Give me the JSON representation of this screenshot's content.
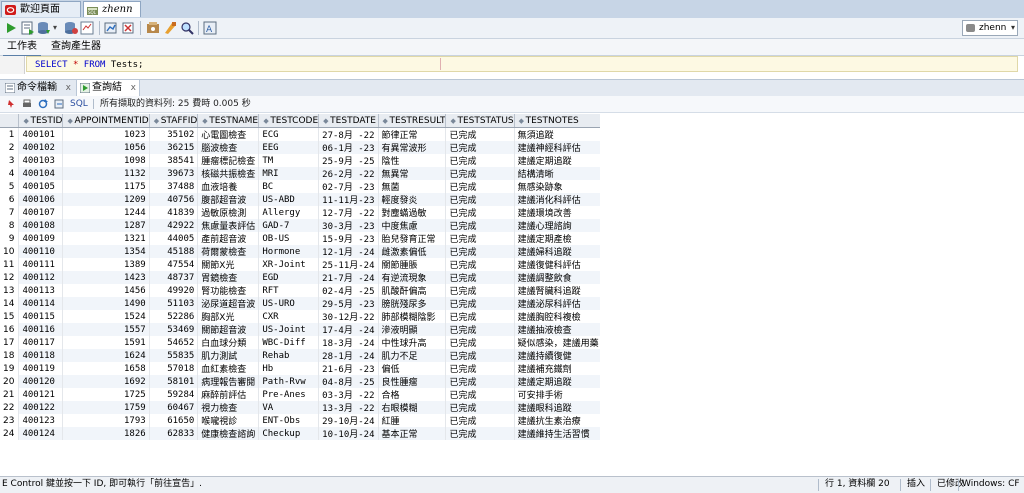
{
  "doc_tabs": [
    {
      "label": "歡迎頁面",
      "icon": "oracle-icon",
      "active": false
    },
    {
      "label": "zhenn",
      "icon": "sql-worksheet-icon",
      "active": true
    }
  ],
  "toolbar": {
    "connection": "zhenn",
    "buttons": [
      "run-icon",
      "run-script-icon",
      "commit-icon",
      "rollback-icon",
      "explain-plan-icon",
      "autotrace-icon",
      "clear-icon",
      "sql-history-icon",
      "format-icon",
      "find-icon",
      "monitor-icon"
    ]
  },
  "worksheet_tabs": [
    "工作表",
    "查詢產生器"
  ],
  "editor": {
    "line": "SELECT * FROM Tests;",
    "kw_select": "SELECT",
    "star": "*",
    "kw_from": "FROM",
    "table": "Tests;"
  },
  "output_tabs": [
    {
      "label": "命令檔輸出",
      "close": "x"
    },
    {
      "label": "查詢結果",
      "close": "x"
    }
  ],
  "results_bar": {
    "sql_label": "SQL",
    "message": "所有擷取的資料列: 25 費時 0.005 秒"
  },
  "grid": {
    "columns": [
      "TESTID",
      "APPOINTMENTID",
      "STAFFID",
      "TESTNAME",
      "TESTCODE",
      "TESTDATE",
      "TESTRESULT",
      "TESTSTATUS",
      "TESTNOTES"
    ],
    "rows": [
      [
        "1",
        "400101",
        "1023",
        "35102",
        "心電圖檢查",
        "ECG",
        "27-8月 -22",
        "節律正常",
        "已完成",
        "無須追蹤"
      ],
      [
        "2",
        "400102",
        "1056",
        "36215",
        "腦波檢查",
        "EEG",
        "06-1月 -23",
        "有異常波形",
        "已完成",
        "建議神經科評估"
      ],
      [
        "3",
        "400103",
        "1098",
        "38541",
        "腫瘤標記檢查",
        "TM",
        "25-9月 -25",
        "陰性",
        "已完成",
        "建議定期追蹤"
      ],
      [
        "4",
        "400104",
        "1132",
        "39673",
        "核磁共振檢查",
        "MRI",
        "26-2月 -22",
        "無異常",
        "已完成",
        "結構清晰"
      ],
      [
        "5",
        "400105",
        "1175",
        "37488",
        "血液培養",
        "BC",
        "02-7月 -23",
        "無菌",
        "已完成",
        "無感染跡象"
      ],
      [
        "6",
        "400106",
        "1209",
        "40756",
        "腹部超音波",
        "US-ABD",
        "11-11月-23",
        "輕度發炎",
        "已完成",
        "建議消化科評估"
      ],
      [
        "7",
        "400107",
        "1244",
        "41839",
        "過敏原檢測",
        "Allergy",
        "12-7月 -22",
        "對塵蟎過敏",
        "已完成",
        "建議環境改善"
      ],
      [
        "8",
        "400108",
        "1287",
        "42922",
        "焦慮量表評估",
        "GAD-7",
        "30-3月 -23",
        "中度焦慮",
        "已完成",
        "建議心理諮詢"
      ],
      [
        "9",
        "400109",
        "1321",
        "44005",
        "產前超音波",
        "OB-US",
        "15-9月 -23",
        "胎兒發育正常",
        "已完成",
        "建議定期產檢"
      ],
      [
        "10",
        "400110",
        "1354",
        "45188",
        "荷爾蒙檢查",
        "Hormone",
        "12-1月 -24",
        "雌激素偏低",
        "已完成",
        "建議婦科追蹤"
      ],
      [
        "11",
        "400111",
        "1389",
        "47554",
        "關節X光",
        "XR-Joint",
        "25-11月-24",
        "關節腫脹",
        "已完成",
        "建議復健科評估"
      ],
      [
        "12",
        "400112",
        "1423",
        "48737",
        "胃鏡檢查",
        "EGD",
        "21-7月 -24",
        "有逆流現象",
        "已完成",
        "建議調整飲食"
      ],
      [
        "13",
        "400113",
        "1456",
        "49920",
        "腎功能檢查",
        "RFT",
        "02-4月 -25",
        "肌酸酐偏高",
        "已完成",
        "建議腎臟科追蹤"
      ],
      [
        "14",
        "400114",
        "1490",
        "51103",
        "泌尿道超音波",
        "US-URO",
        "29-5月 -23",
        "膀胱殘尿多",
        "已完成",
        "建議泌尿科評估"
      ],
      [
        "15",
        "400115",
        "1524",
        "52286",
        "胸部X光",
        "CXR",
        "30-12月-22",
        "肺部模糊陰影",
        "已完成",
        "建議胸腔科複檢"
      ],
      [
        "16",
        "400116",
        "1557",
        "53469",
        "關節超音波",
        "US-Joint",
        "17-4月 -24",
        "滲液明顯",
        "已完成",
        "建議抽液檢查"
      ],
      [
        "17",
        "400117",
        "1591",
        "54652",
        "白血球分類",
        "WBC-Diff",
        "18-3月 -24",
        "中性球升高",
        "已完成",
        "疑似感染，建議用藥"
      ],
      [
        "18",
        "400118",
        "1624",
        "55835",
        "肌力測試",
        "Rehab",
        "28-1月 -24",
        "肌力不足",
        "已完成",
        "建議持續復健"
      ],
      [
        "19",
        "400119",
        "1658",
        "57018",
        "血紅素檢查",
        "Hb",
        "21-6月 -23",
        "偏低",
        "已完成",
        "建議補充鐵劑"
      ],
      [
        "20",
        "400120",
        "1692",
        "58101",
        "病理報告審閱",
        "Path-Rvw",
        "04-8月 -25",
        "良性腫瘤",
        "已完成",
        "建議定期追蹤"
      ],
      [
        "21",
        "400121",
        "1725",
        "59284",
        "麻醉前評估",
        "Pre-Anes",
        "03-3月 -22",
        "合格",
        "已完成",
        "可安排手術"
      ],
      [
        "22",
        "400122",
        "1759",
        "60467",
        "視力檢查",
        "VA",
        "13-3月 -22",
        "右眼模糊",
        "已完成",
        "建議眼科追蹤"
      ],
      [
        "23",
        "400123",
        "1793",
        "61650",
        "喉嚨視診",
        "ENT-Obs",
        "29-10月-24",
        "紅腫",
        "已完成",
        "建議抗生素治療"
      ],
      [
        "24",
        "400124",
        "1826",
        "62833",
        "健康檢查諮詢",
        "Checkup",
        "10-10月-24",
        "基本正常",
        "已完成",
        "建議維持生活習慣"
      ]
    ]
  },
  "status_bar": {
    "hint": "E Control 鍵並按一下 ID, 即可執行「前往宣告」.",
    "position": "行 1, 資料欄 20",
    "mode": "插入",
    "modified": "已修改",
    "platform": "Windows: CF"
  },
  "colors": {
    "accent": "#5b7fa8",
    "editor_bg": "#fdf9e3",
    "alt_row": "#f1f5fa"
  }
}
